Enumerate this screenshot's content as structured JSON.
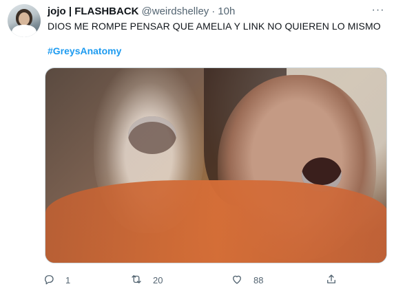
{
  "tweet": {
    "display_name": "jojo | FLASHBACK",
    "handle": "@weirdshelley",
    "separator": "·",
    "time": "10h",
    "text": "DIOS ME ROMPE PENSAR QUE AMELIA Y LINK NO QUIEREN LO MISMO",
    "hashtag": "#GreysAnatomy",
    "more_icon": "···",
    "stats": {
      "replies": "1",
      "retweets": "20",
      "likes": "88"
    },
    "icons": {
      "reply": "reply-icon",
      "retweet": "retweet-icon",
      "like": "heart-icon",
      "share": "share-icon"
    }
  },
  "colors": {
    "accent": "#1d9bf0",
    "secondary_text": "#536471",
    "primary_text": "#0f1419",
    "border": "#cfd9de"
  }
}
